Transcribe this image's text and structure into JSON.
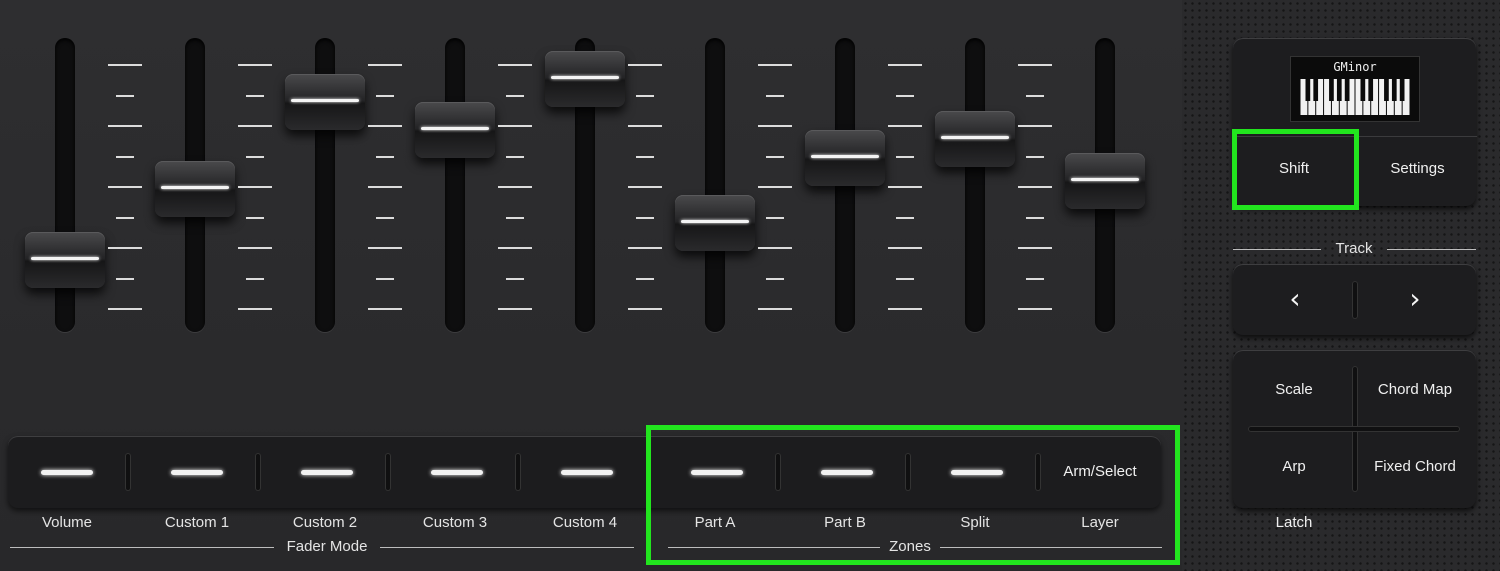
{
  "faders": [
    {
      "id": "fader-1",
      "level": 0.22
    },
    {
      "id": "fader-2",
      "level": 0.47
    },
    {
      "id": "fader-3",
      "level": 0.78
    },
    {
      "id": "fader-4",
      "level": 0.68
    },
    {
      "id": "fader-5",
      "level": 0.86
    },
    {
      "id": "fader-6",
      "level": 0.35
    },
    {
      "id": "fader-7",
      "level": 0.58
    },
    {
      "id": "fader-8",
      "level": 0.65
    },
    {
      "id": "fader-9",
      "level": 0.5
    }
  ],
  "fader_mode_buttons": [
    {
      "label": "Volume"
    },
    {
      "label": "Custom 1"
    },
    {
      "label": "Custom 2"
    },
    {
      "label": "Custom 3"
    },
    {
      "label": "Custom 4"
    }
  ],
  "zone_buttons": [
    {
      "label": "Part A"
    },
    {
      "label": "Part B"
    },
    {
      "label": "Split"
    }
  ],
  "arm_select": {
    "button_text": "Arm/Select",
    "label": "Layer"
  },
  "groups": {
    "fader_mode": "Fader Mode",
    "zones": "Zones",
    "track": "Track"
  },
  "display": {
    "chord": "GMinor"
  },
  "top_buttons": {
    "shift": "Shift",
    "settings": "Settings"
  },
  "quad_buttons": {
    "scale": "Scale",
    "chord_map": "Chord Map",
    "arp": "Arp",
    "fixed_chord": "Fixed Chord"
  },
  "latch": "Latch",
  "colors": {
    "highlight": "#22e51e",
    "panel": "#2b2b2d",
    "led": "#f2f2f2"
  }
}
